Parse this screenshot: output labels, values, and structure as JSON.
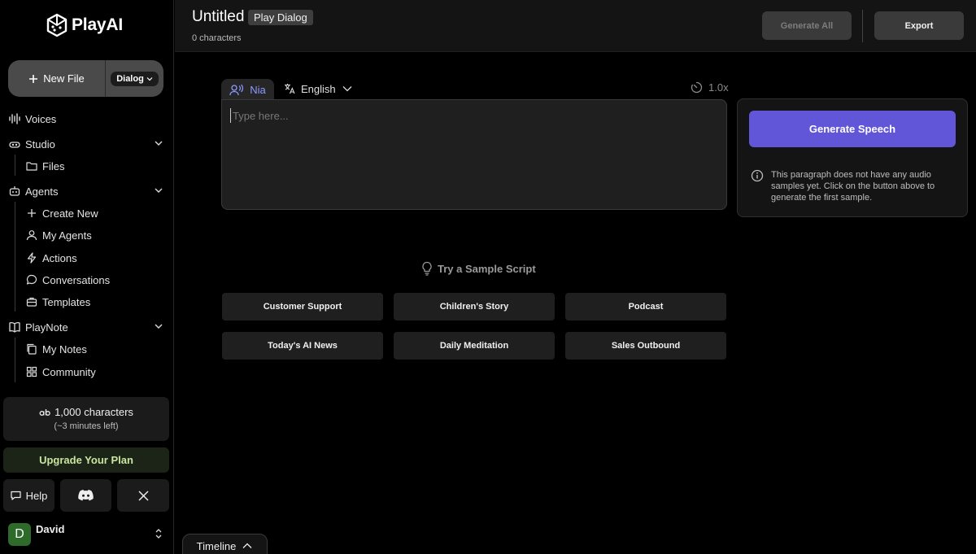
{
  "brand": {
    "name": "PlayAI"
  },
  "sidebar": {
    "new_file_label": "New File",
    "file_type": "Dialog",
    "nav": {
      "voices": "Voices",
      "studio": "Studio",
      "files": "Files",
      "agents": "Agents",
      "create_new": "Create New",
      "my_agents": "My Agents",
      "actions": "Actions",
      "conversations": "Conversations",
      "templates": "Templates",
      "playnote": "PlayNote",
      "my_notes": "My Notes",
      "community": "Community"
    },
    "credits": {
      "amount": "1,000 characters",
      "time_left": "(~3 minutes left)"
    },
    "upgrade_label": "Upgrade Your Plan",
    "help_label": "Help",
    "user": {
      "initial": "D",
      "name": "David"
    }
  },
  "header": {
    "title": "Untitled",
    "mode_badge": "Play Dialog",
    "char_count": "0 characters",
    "generate_all_label": "Generate All",
    "export_label": "Export"
  },
  "editor": {
    "voice_name": "Nia",
    "language": "English",
    "speed": "1.0x",
    "placeholder": "Type here..."
  },
  "generate": {
    "button_label": "Generate Speech",
    "info_text": "This paragraph does not have any audio samples yet. Click on the button above to generate the first sample."
  },
  "samples": {
    "heading": "Try a Sample Script",
    "items": [
      "Customer Support",
      "Children's Story",
      "Podcast",
      "Today's AI News",
      "Daily Meditation",
      "Sales Outbound"
    ]
  },
  "timeline_label": "Timeline",
  "colors": {
    "accent": "#6155d8",
    "voice_tab_text": "#8c9bff",
    "upgrade_text": "#c8e6a0",
    "avatar_bg": "#2e6b2a"
  }
}
